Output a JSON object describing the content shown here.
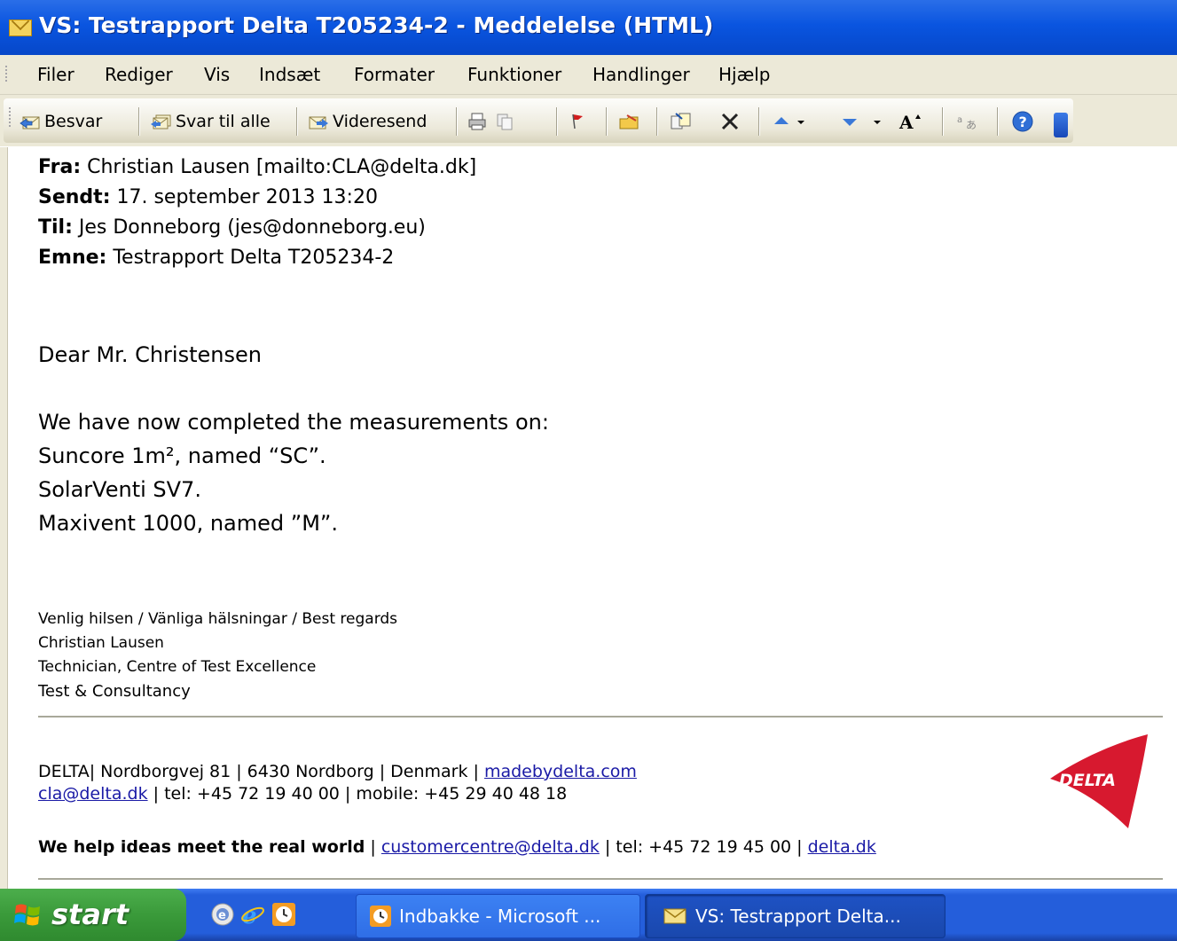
{
  "window": {
    "title": "VS: Testrapport Delta T205234-2 - Meddelelse (HTML)"
  },
  "menu": [
    "Filer",
    "Rediger",
    "Vis",
    "Indsæt",
    "Formater",
    "Funktioner",
    "Handlinger",
    "Hjælp"
  ],
  "toolbar": {
    "reply": "Besvar",
    "reply_all": "Svar til alle",
    "forward": "Videresend"
  },
  "header": {
    "from_label": "Fra:",
    "from_value": " Christian Lausen [mailto:CLA@delta.dk]",
    "sent_label": "Sendt:",
    "sent_value": " 17. september 2013 13:20",
    "to_label": "Til:",
    "to_value": " Jes Donneborg (jes@donneborg.eu)",
    "subject_label": "Emne:",
    "subject_value": " Testrapport Delta T205234-2"
  },
  "body": {
    "greeting": "Dear Mr. Christensen",
    "line1": "We have now completed the measurements on:",
    "line2": "Suncore 1m², named “SC”.",
    "line3": "SolarVenti SV7.",
    "line4": "Maxivent 1000, named ”M”."
  },
  "signature": {
    "regards": "Venlig hilsen / Vänliga hälsningar / Best regards",
    "name": "Christian Lausen",
    "role": "Technician, Centre of Test Excellence",
    "dept": "Test & Consultancy"
  },
  "footer": {
    "address": "DELTA| Nordborgvej 81 | 6430 Nordborg | Denmark | ",
    "website": "madebydelta.com",
    "email": "cla@delta.dk",
    "phones": " | tel: +45 72 19 40 00 | mobile: +45 29 40 48 18",
    "slogan": "We help ideas meet the real world",
    "sep1": " | ",
    "customer_email": "customercentre@delta.dk",
    "tel2": " | tel: +45 72 19 45 00 | ",
    "domain": "delta.dk",
    "logo_text": "DELTA"
  },
  "taskbar": {
    "start": "start",
    "task1": "Indbakke - Microsoft ...",
    "task2": "VS: Testrapport Delta..."
  }
}
